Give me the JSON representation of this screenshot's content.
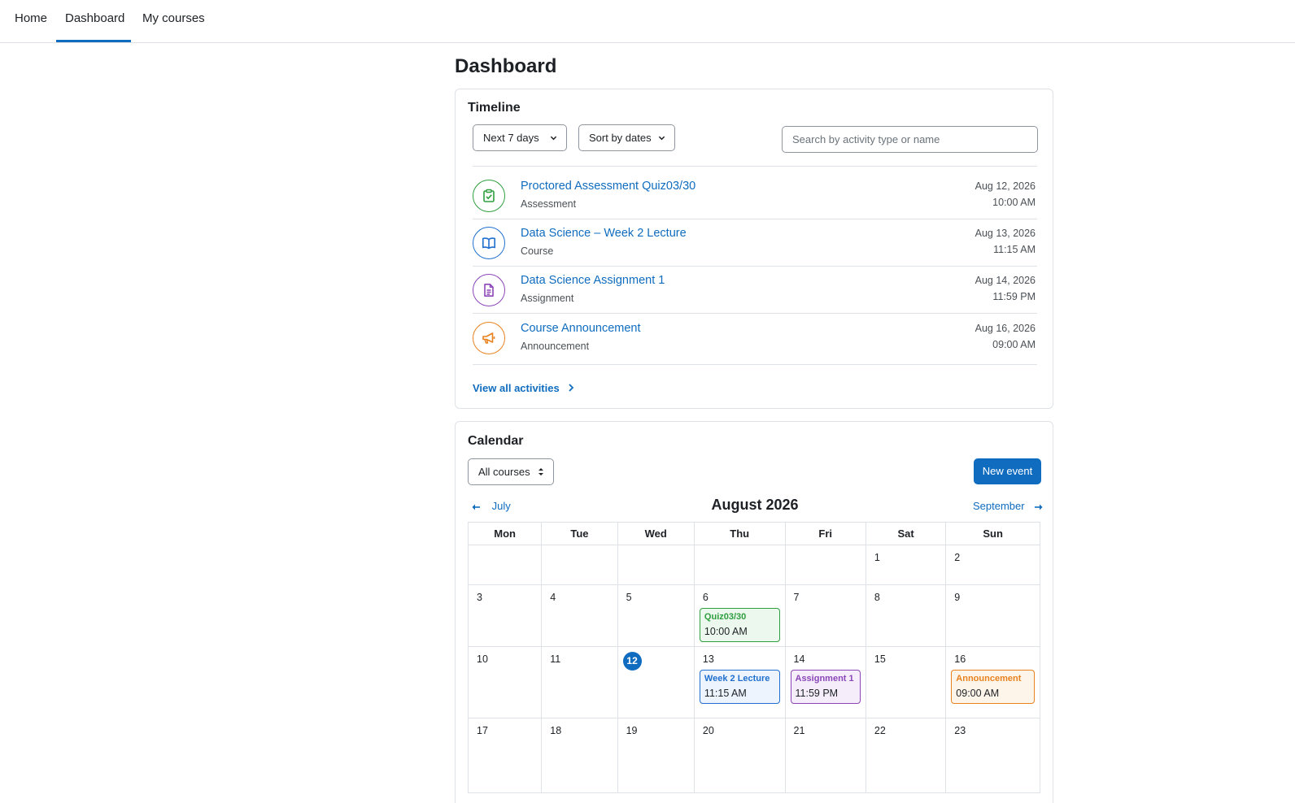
{
  "nav": {
    "tabs": [
      {
        "label": "Home"
      },
      {
        "label": "Dashboard"
      },
      {
        "label": "My courses"
      }
    ]
  },
  "page": {
    "title": "Dashboard"
  },
  "timeline": {
    "title": "Timeline",
    "filter_label": "Next 7 days",
    "sort_label": "Sort by dates",
    "search_placeholder": "Search by activity type or name",
    "items": [
      {
        "name": "Proctored Assessment Quiz03/30",
        "type": "Assessment",
        "date": "Aug 12, 2026",
        "time": "10:00 AM",
        "icon": "clipboard-check-icon",
        "color": "#2e9e3e"
      },
      {
        "name": "Data Science – Week 2 Lecture",
        "type": "Course",
        "date": "Aug 13, 2026",
        "time": "11:15 AM",
        "icon": "open-book-icon",
        "color": "#1f6fcf"
      },
      {
        "name": "Data Science Assignment 1",
        "type": "Assignment",
        "date": "Aug 14, 2026",
        "time": "11:59 PM",
        "icon": "document-icon",
        "color": "#8a46b8"
      },
      {
        "name": "Course Announcement",
        "type": "Announcement",
        "date": "Aug 16, 2026",
        "time": "09:00 AM",
        "icon": "megaphone-icon",
        "color": "#e8821e"
      }
    ],
    "view_all_label": "View all activities"
  },
  "calendar": {
    "title": "Calendar",
    "course_filter": "All courses",
    "new_event_label": "New event",
    "prev_month": "July",
    "next_month": "September",
    "month_title": "August 2026",
    "weekdays": [
      "Mon",
      "Tue",
      "Wed",
      "Thu",
      "Fri",
      "Sat",
      "Sun"
    ],
    "weeks": [
      [
        null,
        null,
        null,
        null,
        null,
        "1",
        "2"
      ],
      [
        "3",
        "4",
        "5",
        "6",
        "7",
        "8",
        "9"
      ],
      [
        "10",
        "11",
        "12",
        "13",
        "14",
        "15",
        "16"
      ],
      [
        "17",
        "18",
        "19",
        "20",
        "21",
        "22",
        "23"
      ]
    ],
    "today": "12",
    "events": {
      "6": {
        "title": "Quiz03/30",
        "time": "10:00 AM",
        "color": "#2e9e3e",
        "bg": "#ecf8ee"
      },
      "13": {
        "title": "Week 2 Lecture",
        "time": "11:15 AM",
        "color": "#1f6fcf",
        "bg": "#edf4fd"
      },
      "14": {
        "title": "Assignment 1",
        "time": "11:59 PM",
        "color": "#8a46b8",
        "bg": "#f5eefa"
      },
      "16": {
        "title": "Announcement",
        "time": "09:00 AM",
        "color": "#e8821e",
        "bg": "#fef5ea"
      }
    }
  }
}
